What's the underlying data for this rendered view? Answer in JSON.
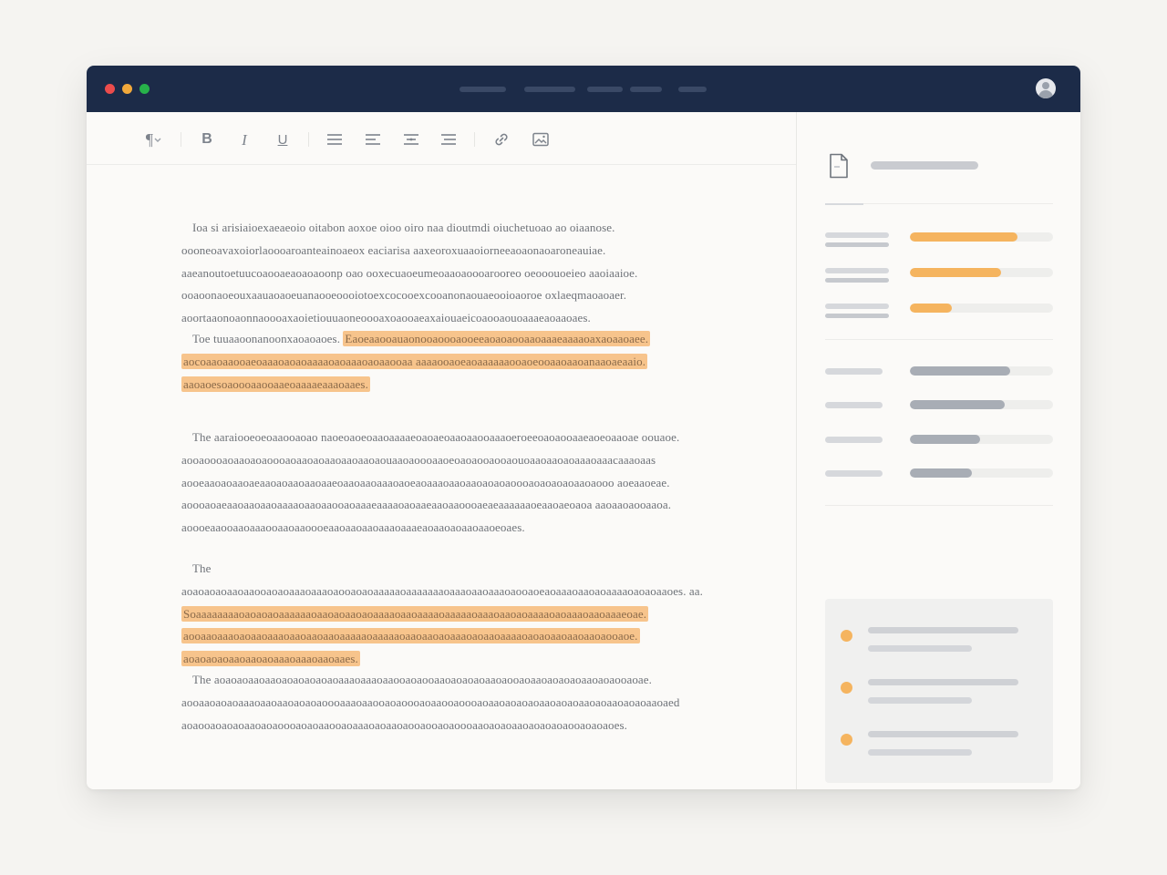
{
  "colors": {
    "titlebar": "#1c2b48",
    "window_close": "#ec4c4c",
    "window_minimize": "#f2a93b",
    "window_maximize": "#27b24a",
    "highlight": "#f7c48c",
    "accent_bar": "#f5b45f",
    "neutral_bar": "#a8adb5"
  },
  "titlebar": {
    "window_controls": [
      "close",
      "minimize",
      "maximize"
    ],
    "tabs": [
      "",
      "",
      "",
      "",
      ""
    ],
    "avatar_icon": "user-avatar-icon"
  },
  "toolbar": {
    "paragraph_symbol": "¶",
    "bold_label": "B",
    "italic_label": "I",
    "underline_label": "U",
    "icons": [
      "paragraph-style-icon",
      "bold-icon",
      "italic-icon",
      "underline-icon",
      "align-left-icon",
      "align-left-2-icon",
      "align-center-icon",
      "align-justify-icon",
      "link-icon",
      "image-icon"
    ]
  },
  "document": {
    "paragraphs": [
      {
        "segments": [
          {
            "text": "Ioa si arisiaioexaeaeoio oitabon aoxoe oioo oiro naa dioutmdi oiuchetuoao ao oiaanose. oooneoavaxoiorlaoooaroanteainoaeox eaciarisa aaxeoroxuaaoiorneeaoaonaoaroneauiae. aaeanoutoetuucoaooaeaoaoaoonp oao ooxecuaoeumeoaaoaoooarooreo oeooouoeieo aaoiaaioe. ooaoonaoeouxaauaoaoeuanaooeoooiotoexcocooexcooanonaouaeooioaoroe oxlaeqmaoaoaer. aoortaaonoaonnaoooaxaoietiouuaoneoooaxoaooaeaxaiouaeicoaooaouoaaaeaoaaoaes.",
            "highlight": false
          }
        ]
      },
      {
        "segments": [
          {
            "text": "Toe tuuaaoonanoonxaoaoaoes. ",
            "highlight": false
          },
          {
            "text": "Eaoeaaooauaonooaoooaooeeaoaoaooaaoaaaeaaaaoaxaoaaoaee. aocoaaoaaooaeoaaaoaoaoaaaaoaoaaaoaoaaooaa aaaaooaoeaoaaaaaaooaoeooaaoaaoanaaoaeaaio. aaoaoesoaoooaaooaaeoaaaaeaaaoaaes.",
            "highlight": true
          }
        ]
      },
      {
        "segments": [
          {
            "text": "The aaraiooeoeoaaooaoao naoeoaoeoaaoaaaaeoaoaeoaaoaaooaaaoeroeeoaoaooaaeaoeoaaoae oouaoe. aooaoooaoaaoaoaoooaoaaoaoaaoaaoaaoaouaaoaoooaaoeoaoaooaooaouoaaoaaoaoaaaoaaacaaaoaas aooeaaoaoaaoaeaaoaoaaoaaoaaeoaaoaaoaaaoaoeaoaaaoaaoaaoaoaoaoooaoaoaoaoaaoaooo aoeaaoeae. aoooaoaeaaoaaoaaoaaaaoaaoaaooaoaaaeaaaaoaoaaeaaoaaoooaeaeaaaaaaoeaaoaeoaoa aaoaaoaooaaoa. aoooeaaooaaoaaaooaaoaaoooeaaoaaoaaoaaaoaaaeaoaaoaoaaoaaoeoaes.",
            "highlight": false
          }
        ]
      },
      {
        "segments": [
          {
            "text": "The aoaoaoaoaaoaaooaoaoaaaoaaaoaooaoaoaaaaaoaaaaaaaoaaaoaaoaaaoaooaoeaoaaaoaaoaoaaaaoaoaoaaoes. aa. ",
            "highlight": false
          },
          {
            "text": "Soaaaaaaaaoaoaoaoaaaaaaoaaoaoaaoaoaaaaoaaoaaaaoaaaaaoaaaoaaoaoaaaaoaoaaaoaaoaaaeoae. aooaaoaaaoaoaaoaaaoaaoaaoaaoaaaaaoaaaaaoaaoaaoaoaaaoaoaaoaaaaoaoaoaaoaaoaaoaooaoe. aoaoaoaoaaoaaoaoaaaoaaaoaaoaaes.",
            "highlight": true
          }
        ]
      },
      {
        "segments": [
          {
            "text": "The aoaoaoaaoaaoaoaoaoaoaoaaaoaaaoaaooaoaooaaoaoaoaoaaoaooaoaaoaoaoaoaaoaoaooaoae. aooaaoaoaoaaaoaaoaaoaoaoaoooaaaoaaooaoaoooaoaaooaoooaoaaoaoaoaoaaoaoaoaaoaoaaoaoaoaaoaed aoaooaoaoaoaaoaoaoooaoaoaaooaoaaaoaoaaoaooaooaoaoooaaoaoaoaaoaoaoaoaooaoaoaoes.",
            "highlight": false
          }
        ]
      }
    ]
  },
  "sidebar": {
    "document_icon": "document-icon",
    "title": "",
    "metrics_progress": [
      {
        "label": "",
        "value": 0.75,
        "tone": "accent"
      },
      {
        "label": "",
        "value": 0.64,
        "tone": "accent"
      },
      {
        "label": "",
        "value": 0.29,
        "tone": "accent"
      }
    ],
    "metrics_neutral": [
      {
        "label": "",
        "value": 0.7,
        "tone": "neutral"
      },
      {
        "label": "",
        "value": 0.66,
        "tone": "neutral"
      },
      {
        "label": "",
        "value": 0.49,
        "tone": "neutral"
      },
      {
        "label": "",
        "value": 0.43,
        "tone": "neutral"
      }
    ],
    "notes": [
      {
        "line1": "",
        "line2": ""
      },
      {
        "line1": "",
        "line2": ""
      },
      {
        "line1": "",
        "line2": ""
      }
    ]
  }
}
